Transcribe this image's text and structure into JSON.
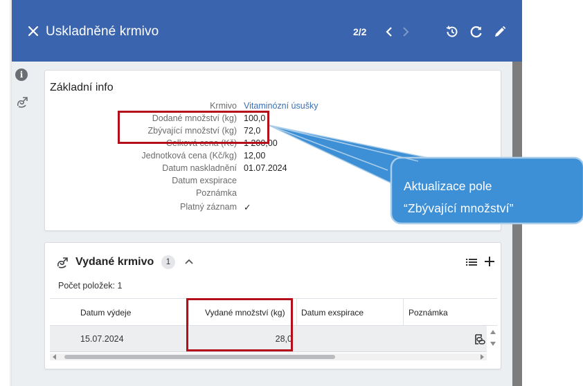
{
  "header": {
    "title": "Uskladněné krmivo",
    "pager": "2/2",
    "bg_color": "#3a64ad"
  },
  "basic_info": {
    "title": "Základní info",
    "fields": [
      {
        "label": "Krmivo",
        "value": "Vitaminózní úsušky",
        "link": true
      },
      {
        "label": "Dodané množství (kg)",
        "value": "100,0"
      },
      {
        "label": "Zbývající množství (kg)",
        "value": "72,0"
      },
      {
        "label": "Celková cena (Kč)",
        "value": "1 200,00"
      },
      {
        "label": "Jednotková cena (Kč/kg)",
        "value": "12,00"
      },
      {
        "label": "Datum naskladnění",
        "value": "01.07.2024"
      },
      {
        "label": "Datum exspirace",
        "value": ""
      },
      {
        "label": "Poznámka",
        "value": ""
      },
      {
        "label": "Platný záznam",
        "value": "✓"
      }
    ]
  },
  "issued": {
    "title": "Vydané krmivo",
    "count_badge": "1",
    "item_count": "Počet položek: 1",
    "columns": [
      "Datum výdeje",
      "Vydané množství (kg)",
      "Datum exspirace",
      "Poznámka"
    ],
    "rows": [
      {
        "date": "15.07.2024",
        "amount": "28,0",
        "expiry": "",
        "note": ""
      }
    ]
  },
  "callout": {
    "line1": "Aktualizace pole",
    "line2": "“Zbývající množství”",
    "fill": "#3d8fd6",
    "border": "#a9cde9"
  },
  "highlight_color": "#b30e1a"
}
